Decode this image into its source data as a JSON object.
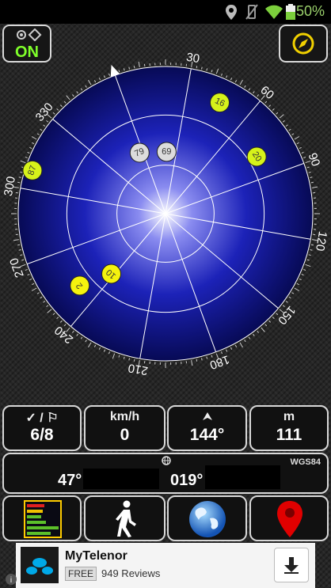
{
  "status": {
    "battery": "50%"
  },
  "header": {
    "gps_toggle": "ON"
  },
  "sky": {
    "azimuth_labels": [
      "30",
      "60",
      "90",
      "120",
      "150",
      "180",
      "210",
      "240",
      "270",
      "300",
      "330"
    ],
    "satellites": [
      {
        "id": "87",
        "color": "#d6f21a",
        "az": -52,
        "r": 0.95
      },
      {
        "id": "16",
        "color": "#d6f21a",
        "az": 46,
        "r": 0.84
      },
      {
        "id": "79",
        "color": "#dcdcdc",
        "az": -3,
        "r": 0.45
      },
      {
        "id": "69",
        "color": "#dcdcdc",
        "az": 21,
        "r": 0.42
      },
      {
        "id": "20",
        "color": "#d6f21a",
        "az": 78,
        "r": 0.73
      },
      {
        "id": "2",
        "color": "#f4f20e",
        "az": -110,
        "r": 0.76
      },
      {
        "id": "10",
        "color": "#f4f20e",
        "az": -118,
        "r": 0.55
      }
    ]
  },
  "panels": {
    "sats": {
      "label": "✓ / ⚐",
      "value": "6/8"
    },
    "speed": {
      "label": "km/h",
      "value": "0"
    },
    "heading": {
      "label": "",
      "value": "144°"
    },
    "altitude": {
      "label": "m",
      "value": "111"
    }
  },
  "coords": {
    "datum": "WGS84",
    "lat": "47°",
    "lon": "019°"
  },
  "ad": {
    "name": "MyTelenor",
    "free": "FREE",
    "reviews": "949 Reviews"
  }
}
